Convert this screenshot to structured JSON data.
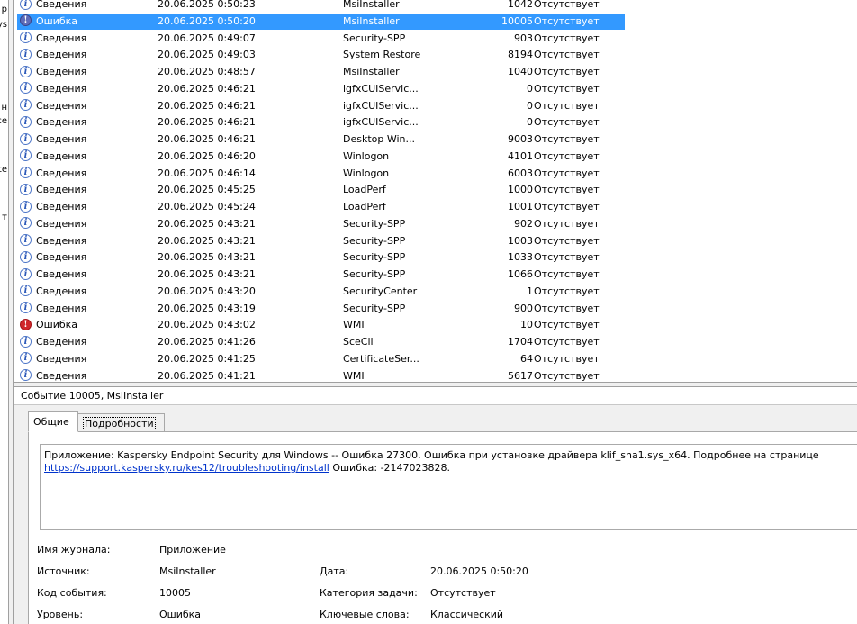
{
  "left_edge_fragments": [
    "р",
    "ys",
    "н",
    "ce",
    "te",
    "т"
  ],
  "events": [
    {
      "level": "Сведения",
      "icon": "info",
      "date": "20.06.2025 0:50:23",
      "source": "MsiInstaller",
      "id": "1042",
      "task": "Отсутствует"
    },
    {
      "level": "Ошибка",
      "icon": "error",
      "date": "20.06.2025 0:50:20",
      "source": "MsiInstaller",
      "id": "10005",
      "task": "Отсутствует",
      "selected": true
    },
    {
      "level": "Сведения",
      "icon": "info",
      "date": "20.06.2025 0:49:07",
      "source": "Security-SPP",
      "id": "903",
      "task": "Отсутствует"
    },
    {
      "level": "Сведения",
      "icon": "info",
      "date": "20.06.2025 0:49:03",
      "source": "System Restore",
      "id": "8194",
      "task": "Отсутствует"
    },
    {
      "level": "Сведения",
      "icon": "info",
      "date": "20.06.2025 0:48:57",
      "source": "MsiInstaller",
      "id": "1040",
      "task": "Отсутствует"
    },
    {
      "level": "Сведения",
      "icon": "info",
      "date": "20.06.2025 0:46:21",
      "source": "igfxCUIServic...",
      "id": "0",
      "task": "Отсутствует"
    },
    {
      "level": "Сведения",
      "icon": "info",
      "date": "20.06.2025 0:46:21",
      "source": "igfxCUIServic...",
      "id": "0",
      "task": "Отсутствует"
    },
    {
      "level": "Сведения",
      "icon": "info",
      "date": "20.06.2025 0:46:21",
      "source": "igfxCUIServic...",
      "id": "0",
      "task": "Отсутствует"
    },
    {
      "level": "Сведения",
      "icon": "info",
      "date": "20.06.2025 0:46:21",
      "source": "Desktop Win...",
      "id": "9003",
      "task": "Отсутствует"
    },
    {
      "level": "Сведения",
      "icon": "info",
      "date": "20.06.2025 0:46:20",
      "source": "Winlogon",
      "id": "4101",
      "task": "Отсутствует"
    },
    {
      "level": "Сведения",
      "icon": "info",
      "date": "20.06.2025 0:46:14",
      "source": "Winlogon",
      "id": "6003",
      "task": "Отсутствует"
    },
    {
      "level": "Сведения",
      "icon": "info",
      "date": "20.06.2025 0:45:25",
      "source": "LoadPerf",
      "id": "1000",
      "task": "Отсутствует"
    },
    {
      "level": "Сведения",
      "icon": "info",
      "date": "20.06.2025 0:45:24",
      "source": "LoadPerf",
      "id": "1001",
      "task": "Отсутствует"
    },
    {
      "level": "Сведения",
      "icon": "info",
      "date": "20.06.2025 0:43:21",
      "source": "Security-SPP",
      "id": "902",
      "task": "Отсутствует"
    },
    {
      "level": "Сведения",
      "icon": "info",
      "date": "20.06.2025 0:43:21",
      "source": "Security-SPP",
      "id": "1003",
      "task": "Отсутствует"
    },
    {
      "level": "Сведения",
      "icon": "info",
      "date": "20.06.2025 0:43:21",
      "source": "Security-SPP",
      "id": "1033",
      "task": "Отсутствует"
    },
    {
      "level": "Сведения",
      "icon": "info",
      "date": "20.06.2025 0:43:21",
      "source": "Security-SPP",
      "id": "1066",
      "task": "Отсутствует"
    },
    {
      "level": "Сведения",
      "icon": "info",
      "date": "20.06.2025 0:43:20",
      "source": "SecurityCenter",
      "id": "1",
      "task": "Отсутствует"
    },
    {
      "level": "Сведения",
      "icon": "info",
      "date": "20.06.2025 0:43:19",
      "source": "Security-SPP",
      "id": "900",
      "task": "Отсутствует"
    },
    {
      "level": "Ошибка",
      "icon": "error",
      "date": "20.06.2025 0:43:02",
      "source": "WMI",
      "id": "10",
      "task": "Отсутствует"
    },
    {
      "level": "Сведения",
      "icon": "info",
      "date": "20.06.2025 0:41:26",
      "source": "SceCli",
      "id": "1704",
      "task": "Отсутствует"
    },
    {
      "level": "Сведения",
      "icon": "info",
      "date": "20.06.2025 0:41:25",
      "source": "CertificateSer...",
      "id": "64",
      "task": "Отсутствует"
    },
    {
      "level": "Сведения",
      "icon": "info",
      "date": "20.06.2025 0:41:21",
      "source": "WMI",
      "id": "5617",
      "task": "Отсутствует"
    }
  ],
  "detail": {
    "header": "Событие 10005, MsiInstaller",
    "tabs": {
      "general": "Общие",
      "details": "Подробности"
    },
    "message": "Приложение: Kaspersky Endpoint Security для Windows -- Ошибка 27300. Ошибка при установке драйвера klif_sha1.sys_x64. Подробнее на странице",
    "message_link": "https://support.kaspersky.ru/kes12/troubleshooting/install",
    "message_tail": " Ошибка: -2147023828.",
    "fields": {
      "log_label": "Имя журнала:",
      "log_value": "Приложение",
      "source_label": "Источник:",
      "source_value": "MsiInstaller",
      "date_label": "Дата:",
      "date_value": "20.06.2025 0:50:20",
      "event_id_label": "Код события:",
      "event_id_value": "10005",
      "task_label": "Категория задачи:",
      "task_value": "Отсутствует",
      "level_label": "Уровень:",
      "level_value": "Ошибка",
      "keywords_label": "Ключевые слова:",
      "keywords_value": "Классический"
    }
  },
  "colors": {
    "selection": "#3399ff",
    "error_icon": "#d0262a",
    "info_icon": "#2a57b8",
    "link": "#0033cc"
  }
}
